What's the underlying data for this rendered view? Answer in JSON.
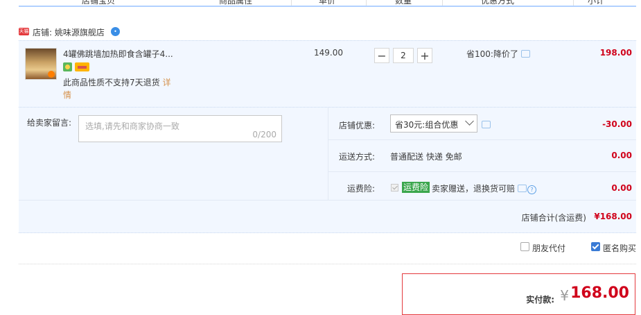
{
  "header": {
    "col_item": "店铺宝贝",
    "col_attr": "商品属性",
    "col_price": "单价",
    "col_qty": "数量",
    "col_promo": "优惠方式",
    "col_subtotal": "小计"
  },
  "shop": {
    "badge": "天猫",
    "label": "店铺: 姚味源旗舰店"
  },
  "item": {
    "title": "4罐佛跳墙加热即食含罐子4...",
    "no_return_text": "此商品性质不支持7天退货",
    "no_return_link": "详情",
    "unit_price": "149.00",
    "qty_minus": "−",
    "qty_value": "2",
    "qty_plus": "+",
    "discount": "省100:降价了",
    "subtotal": "198.00"
  },
  "options": {
    "message_label": "给卖家留言:",
    "message_placeholder": "选填,请先和商家协商一致",
    "message_count": "0/200",
    "shop_discount_label": "店铺优惠:",
    "shop_discount_value": "省30元:组合优惠",
    "shop_discount_amount": "-30.00",
    "shipping_label": "运送方式:",
    "shipping_value": "普通配送 快递 免邮",
    "shipping_amount": "0.00",
    "insurance_label": "运费险:",
    "insurance_tag": "运费险",
    "insurance_text": "卖家赠送，退换货可赔",
    "insurance_amount": "0.00",
    "shop_total_label": "店铺合计(含运费)",
    "shop_total_value": "¥168.00"
  },
  "footer": {
    "friend_pay_label": "朋友代付",
    "friend_pay_checked": false,
    "anonymous_label": "匿名购买",
    "anonymous_checked": true,
    "pay_label": "实付款:",
    "pay_currency": "¥",
    "pay_amount": "168.00"
  },
  "colors": {
    "accent_red": "#d0021b",
    "header_line": "#b2d1ff",
    "row_bg": "#f2f7ff",
    "insurance_green": "#3aa64c"
  }
}
